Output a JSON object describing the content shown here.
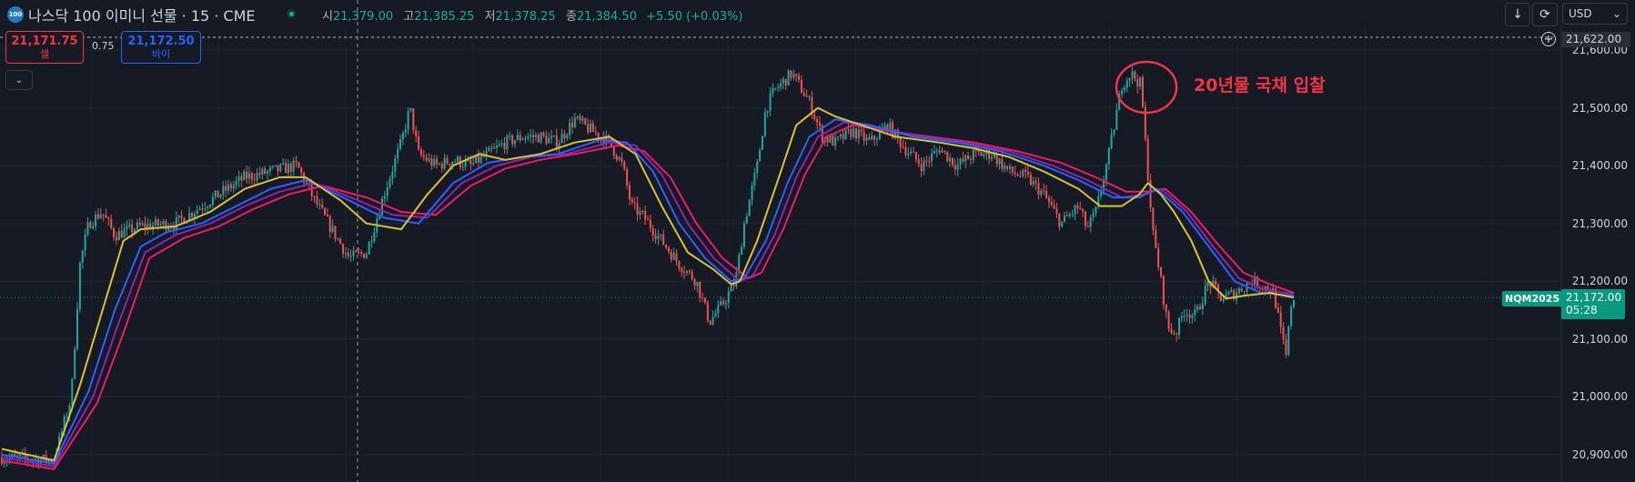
{
  "header": {
    "logo_text": "100",
    "title": "나스닥 100 이미니 선물 · 15 · CME",
    "ohlc": {
      "open_label": "시",
      "open": "21,379.00",
      "high_label": "고",
      "high": "21,385.25",
      "low_label": "저",
      "low": "21,378.25",
      "close_label": "종",
      "close": "21,384.50",
      "change": "+5.50 (+0.03%)"
    }
  },
  "trade_panel": {
    "sell_price": "21,171.75",
    "sell_label": "셀",
    "spread": "0.75",
    "buy_price": "21,172.50",
    "buy_label": "바이"
  },
  "toolbar": {
    "currency": "USD",
    "currency_arrow": "⌄",
    "down_icon": "↓",
    "refresh_icon": "⟳",
    "collapse_icon": "⌄",
    "plus_icon": "+"
  },
  "price_axis": {
    "ticks": [
      "21,600.00",
      "21,500.00",
      "21,400.00",
      "21,300.00",
      "21,200.00",
      "21,100.00",
      "21,000.00",
      "20,900.00"
    ],
    "alert_price": "21,622.00",
    "last_price": "21,172.00",
    "countdown": "05:28",
    "symbol_tag": "NQM2025"
  },
  "annotation": {
    "text": "20년물 국채 입찰"
  },
  "colors": {
    "background": "#161a25",
    "up": "#26a69a",
    "down": "#ef5350",
    "ma_yellow": "#d8c335",
    "ma_blue": "#2962ff",
    "ma_purple": "#8e24aa",
    "ma_red": "#e91e63",
    "annotation": "#f23645"
  },
  "chart_data": {
    "type": "candlestick",
    "ylim": [
      20880,
      21640
    ],
    "y_ticks": [
      21600,
      21500,
      21400,
      21300,
      21200,
      21100,
      21000,
      20900
    ],
    "last_price": 21172,
    "alert_price": 21622,
    "close_path": [
      [
        0,
        20895
      ],
      [
        60,
        20890
      ],
      [
        80,
        21000
      ],
      [
        90,
        21230
      ],
      [
        100,
        21300
      ],
      [
        115,
        21320
      ],
      [
        130,
        21280
      ],
      [
        160,
        21295
      ],
      [
        200,
        21300
      ],
      [
        240,
        21340
      ],
      [
        280,
        21380
      ],
      [
        310,
        21390
      ],
      [
        340,
        21400
      ],
      [
        360,
        21340
      ],
      [
        380,
        21290
      ],
      [
        400,
        21240
      ],
      [
        420,
        21250
      ],
      [
        440,
        21350
      ],
      [
        460,
        21440
      ],
      [
        470,
        21500
      ],
      [
        480,
        21420
      ],
      [
        500,
        21400
      ],
      [
        520,
        21410
      ],
      [
        540,
        21400
      ],
      [
        560,
        21420
      ],
      [
        580,
        21440
      ],
      [
        600,
        21450
      ],
      [
        620,
        21450
      ],
      [
        640,
        21440
      ],
      [
        660,
        21480
      ],
      [
        680,
        21460
      ],
      [
        700,
        21440
      ],
      [
        715,
        21400
      ],
      [
        725,
        21330
      ],
      [
        740,
        21310
      ],
      [
        760,
        21270
      ],
      [
        780,
        21230
      ],
      [
        800,
        21200
      ],
      [
        815,
        21130
      ],
      [
        830,
        21160
      ],
      [
        845,
        21200
      ],
      [
        855,
        21300
      ],
      [
        870,
        21400
      ],
      [
        880,
        21500
      ],
      [
        890,
        21530
      ],
      [
        910,
        21560
      ],
      [
        930,
        21510
      ],
      [
        945,
        21450
      ],
      [
        960,
        21440
      ],
      [
        980,
        21460
      ],
      [
        1000,
        21440
      ],
      [
        1020,
        21470
      ],
      [
        1040,
        21430
      ],
      [
        1060,
        21400
      ],
      [
        1080,
        21430
      ],
      [
        1100,
        21400
      ],
      [
        1120,
        21420
      ],
      [
        1140,
        21420
      ],
      [
        1160,
        21390
      ],
      [
        1180,
        21380
      ],
      [
        1200,
        21350
      ],
      [
        1220,
        21300
      ],
      [
        1240,
        21330
      ],
      [
        1250,
        21290
      ],
      [
        1260,
        21320
      ],
      [
        1275,
        21420
      ],
      [
        1290,
        21540
      ],
      [
        1300,
        21560
      ],
      [
        1312,
        21540
      ],
      [
        1318,
        21420
      ],
      [
        1326,
        21280
      ],
      [
        1334,
        21210
      ],
      [
        1343,
        21120
      ],
      [
        1352,
        21110
      ],
      [
        1362,
        21150
      ],
      [
        1375,
        21140
      ],
      [
        1390,
        21200
      ],
      [
        1405,
        21170
      ],
      [
        1420,
        21180
      ],
      [
        1440,
        21200
      ],
      [
        1455,
        21190
      ],
      [
        1465,
        21180
      ],
      [
        1472,
        21120
      ],
      [
        1479,
        21070
      ],
      [
        1485,
        21160
      ],
      [
        1488,
        21172
      ]
    ],
    "ma_paths": [
      {
        "name": "",
        "color": "#d8c335",
        "points": [
          [
            0,
            20910
          ],
          [
            60,
            20890
          ],
          [
            90,
            21020
          ],
          [
            120,
            21170
          ],
          [
            140,
            21270
          ],
          [
            160,
            21290
          ],
          [
            200,
            21295
          ],
          [
            240,
            21320
          ],
          [
            280,
            21360
          ],
          [
            320,
            21380
          ],
          [
            350,
            21380
          ],
          [
            390,
            21340
          ],
          [
            420,
            21300
          ],
          [
            460,
            21290
          ],
          [
            490,
            21350
          ],
          [
            520,
            21400
          ],
          [
            550,
            21420
          ],
          [
            580,
            21410
          ],
          [
            620,
            21420
          ],
          [
            660,
            21440
          ],
          [
            700,
            21450
          ],
          [
            730,
            21420
          ],
          [
            760,
            21330
          ],
          [
            790,
            21250
          ],
          [
            820,
            21220
          ],
          [
            840,
            21195
          ],
          [
            850,
            21200
          ],
          [
            870,
            21270
          ],
          [
            895,
            21380
          ],
          [
            915,
            21470
          ],
          [
            940,
            21500
          ],
          [
            960,
            21485
          ],
          [
            990,
            21470
          ],
          [
            1030,
            21450
          ],
          [
            1080,
            21440
          ],
          [
            1120,
            21430
          ],
          [
            1160,
            21415
          ],
          [
            1200,
            21390
          ],
          [
            1240,
            21360
          ],
          [
            1265,
            21330
          ],
          [
            1290,
            21330
          ],
          [
            1310,
            21350
          ],
          [
            1320,
            21370
          ],
          [
            1335,
            21350
          ],
          [
            1350,
            21320
          ],
          [
            1370,
            21270
          ],
          [
            1390,
            21200
          ],
          [
            1410,
            21170
          ],
          [
            1430,
            21175
          ],
          [
            1460,
            21180
          ],
          [
            1488,
            21172
          ]
        ]
      },
      {
        "name": "",
        "color": "#2962ff",
        "points": [
          [
            0,
            20900
          ],
          [
            60,
            20885
          ],
          [
            100,
            21010
          ],
          [
            130,
            21150
          ],
          [
            160,
            21260
          ],
          [
            190,
            21285
          ],
          [
            230,
            21300
          ],
          [
            270,
            21330
          ],
          [
            310,
            21360
          ],
          [
            350,
            21375
          ],
          [
            400,
            21340
          ],
          [
            440,
            21310
          ],
          [
            480,
            21300
          ],
          [
            520,
            21370
          ],
          [
            560,
            21405
          ],
          [
            600,
            21415
          ],
          [
            640,
            21420
          ],
          [
            690,
            21445
          ],
          [
            720,
            21440
          ],
          [
            750,
            21390
          ],
          [
            780,
            21300
          ],
          [
            810,
            21240
          ],
          [
            840,
            21200
          ],
          [
            855,
            21205
          ],
          [
            880,
            21270
          ],
          [
            905,
            21370
          ],
          [
            930,
            21450
          ],
          [
            960,
            21480
          ],
          [
            1000,
            21470
          ],
          [
            1050,
            21450
          ],
          [
            1100,
            21440
          ],
          [
            1150,
            21425
          ],
          [
            1200,
            21400
          ],
          [
            1240,
            21375
          ],
          [
            1280,
            21345
          ],
          [
            1310,
            21345
          ],
          [
            1330,
            21360
          ],
          [
            1360,
            21320
          ],
          [
            1390,
            21260
          ],
          [
            1420,
            21200
          ],
          [
            1450,
            21180
          ],
          [
            1488,
            21175
          ]
        ]
      },
      {
        "name": "",
        "color": "#8e24aa",
        "points": [
          [
            0,
            20895
          ],
          [
            60,
            20880
          ],
          [
            105,
            21000
          ],
          [
            135,
            21130
          ],
          [
            165,
            21250
          ],
          [
            200,
            21280
          ],
          [
            240,
            21300
          ],
          [
            280,
            21330
          ],
          [
            320,
            21355
          ],
          [
            360,
            21370
          ],
          [
            410,
            21340
          ],
          [
            450,
            21315
          ],
          [
            490,
            21310
          ],
          [
            530,
            21370
          ],
          [
            570,
            21400
          ],
          [
            610,
            21415
          ],
          [
            650,
            21420
          ],
          [
            700,
            21440
          ],
          [
            730,
            21435
          ],
          [
            760,
            21385
          ],
          [
            790,
            21300
          ],
          [
            820,
            21240
          ],
          [
            850,
            21200
          ],
          [
            865,
            21210
          ],
          [
            890,
            21280
          ],
          [
            915,
            21380
          ],
          [
            940,
            21450
          ],
          [
            970,
            21475
          ],
          [
            1010,
            21465
          ],
          [
            1060,
            21450
          ],
          [
            1110,
            21440
          ],
          [
            1160,
            21425
          ],
          [
            1210,
            21400
          ],
          [
            1250,
            21375
          ],
          [
            1290,
            21345
          ],
          [
            1315,
            21350
          ],
          [
            1335,
            21360
          ],
          [
            1365,
            21320
          ],
          [
            1395,
            21260
          ],
          [
            1425,
            21205
          ],
          [
            1455,
            21185
          ],
          [
            1488,
            21178
          ]
        ]
      },
      {
        "name": "",
        "color": "#e91e63",
        "points": [
          [
            0,
            20890
          ],
          [
            60,
            20875
          ],
          [
            110,
            20990
          ],
          [
            140,
            21110
          ],
          [
            170,
            21240
          ],
          [
            210,
            21275
          ],
          [
            250,
            21295
          ],
          [
            290,
            21325
          ],
          [
            330,
            21350
          ],
          [
            370,
            21365
          ],
          [
            420,
            21345
          ],
          [
            460,
            21320
          ],
          [
            500,
            21315
          ],
          [
            540,
            21365
          ],
          [
            580,
            21395
          ],
          [
            620,
            21410
          ],
          [
            660,
            21420
          ],
          [
            710,
            21435
          ],
          [
            740,
            21425
          ],
          [
            770,
            21380
          ],
          [
            800,
            21300
          ],
          [
            830,
            21240
          ],
          [
            860,
            21205
          ],
          [
            875,
            21215
          ],
          [
            900,
            21290
          ],
          [
            925,
            21385
          ],
          [
            950,
            21450
          ],
          [
            980,
            21470
          ],
          [
            1020,
            21460
          ],
          [
            1070,
            21450
          ],
          [
            1120,
            21440
          ],
          [
            1170,
            21425
          ],
          [
            1220,
            21405
          ],
          [
            1260,
            21380
          ],
          [
            1295,
            21355
          ],
          [
            1320,
            21355
          ],
          [
            1340,
            21360
          ],
          [
            1370,
            21320
          ],
          [
            1400,
            21265
          ],
          [
            1430,
            21215
          ],
          [
            1460,
            21195
          ],
          [
            1488,
            21180
          ]
        ]
      }
    ]
  }
}
